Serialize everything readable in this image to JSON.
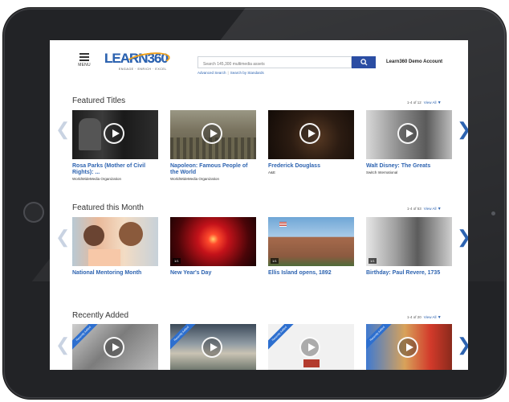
{
  "header": {
    "menu_label": "MENU",
    "logo_text": "LEARN360",
    "logo_tagline": "ENGAGE · ENRICH · EXCEL",
    "search_placeholder": "Search 145,300 multimedia assets",
    "advanced_search": "Advanced Search",
    "search_by_standards": "Search by Standards",
    "account": "Learn360 Demo Account"
  },
  "sections": [
    {
      "title": "Featured Titles",
      "count": "1-4 of 12",
      "view_all": "View All",
      "cards": [
        {
          "title": "Rosa Parks (Mother of Civil Rights): ...",
          "sub": "WorldWideMedia Organization"
        },
        {
          "title": "Napoleon: Famous People of the World",
          "sub": "WorldWideMedia Organization"
        },
        {
          "title": "Frederick Douglass",
          "sub": "A&E"
        },
        {
          "title": "Walt Disney: The Greats",
          "sub": "Switch International"
        }
      ]
    },
    {
      "title": "Featured this Month",
      "count": "1-4 of 53",
      "view_all": "View All",
      "cards": [
        {
          "title": "National Mentoring Month",
          "badge": ""
        },
        {
          "title": "New Year's Day",
          "badge": "1/1"
        },
        {
          "title": "Ellis Island opens, 1892",
          "badge": "1/1"
        },
        {
          "title": "Birthday: Paul Revere, 1735",
          "badge": "1/1"
        }
      ]
    },
    {
      "title": "Recently Added",
      "count": "1-4 of 20",
      "view_all": "View All",
      "ribbon": "Recently Added"
    }
  ],
  "colors": {
    "brand": "#2d63b0",
    "search_button": "#2b4da3",
    "ribbon": "#2d6fcf",
    "accent": "#f2a21b"
  },
  "icons": {
    "menu": "hamburger-icon",
    "search": "search-icon",
    "prev": "chevron-left-icon",
    "next": "chevron-right-icon",
    "play": "play-icon"
  }
}
